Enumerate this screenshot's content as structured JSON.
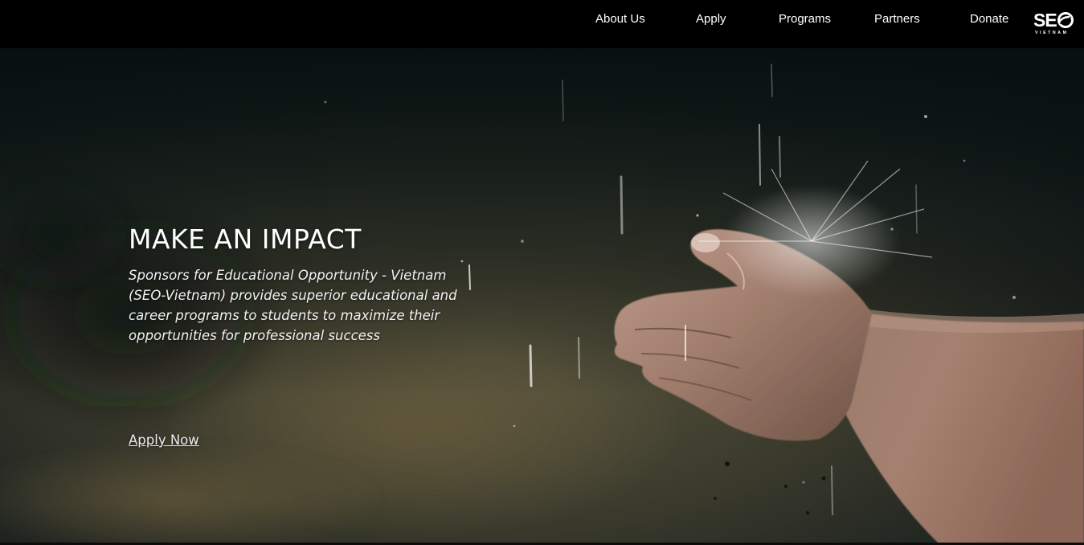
{
  "nav": {
    "items": [
      {
        "label": "About Us"
      },
      {
        "label": "Apply"
      },
      {
        "label": "Programs"
      },
      {
        "label": "Partners"
      },
      {
        "label": "Donate"
      }
    ],
    "logo": {
      "text": "SEO",
      "subtext": "VIETNAM",
      "icon": "seo-vietnam-logo"
    }
  },
  "hero": {
    "title": "MAKE AN IMPACT",
    "description": "Sponsors for Educational Opportunity - Vietnam (SEO-Vietnam) provides superior educational and career programs to students to maximize their opportunities for professional success",
    "cta_label": "Apply Now",
    "background": "hands-in-rain-photo"
  },
  "colors": {
    "nav_background": "#000000",
    "text": "#ffffff"
  }
}
